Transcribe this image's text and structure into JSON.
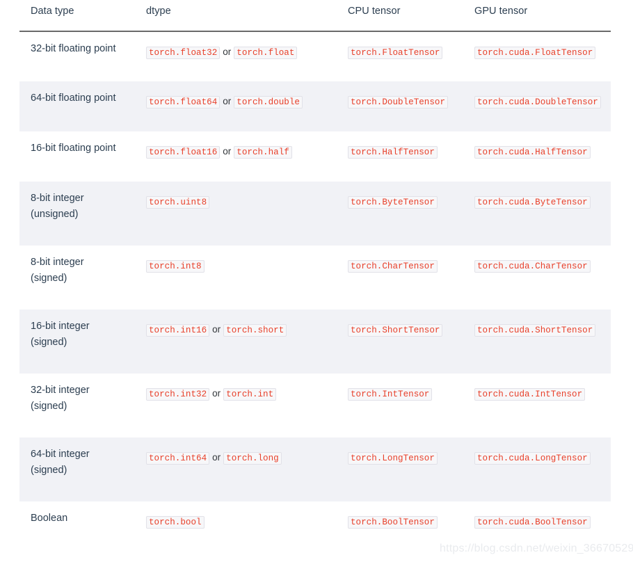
{
  "table": {
    "headers": [
      {
        "label": "Data type"
      },
      {
        "label": "dtype"
      },
      {
        "label": "CPU tensor"
      },
      {
        "label": "GPU tensor"
      }
    ],
    "rows": [
      {
        "data_type_line1": "32-bit floating point",
        "data_type_line2": "",
        "dtype_primary": "torch.float32",
        "dtype_conjunction": "or",
        "dtype_alt": "torch.float",
        "cpu_tensor": "torch.FloatTensor",
        "gpu_tensor": "torch.cuda.FloatTensor"
      },
      {
        "data_type_line1": "64-bit floating point",
        "data_type_line2": "",
        "dtype_primary": "torch.float64",
        "dtype_conjunction": "or",
        "dtype_alt": "torch.double",
        "cpu_tensor": "torch.DoubleTensor",
        "gpu_tensor": "torch.cuda.DoubleTensor"
      },
      {
        "data_type_line1": "16-bit floating point",
        "data_type_line2": "",
        "dtype_primary": "torch.float16",
        "dtype_conjunction": "or",
        "dtype_alt": "torch.half",
        "cpu_tensor": "torch.HalfTensor",
        "gpu_tensor": "torch.cuda.HalfTensor"
      },
      {
        "data_type_line1": "8-bit integer",
        "data_type_line2": "(unsigned)",
        "dtype_primary": "torch.uint8",
        "dtype_conjunction": "",
        "dtype_alt": "",
        "cpu_tensor": "torch.ByteTensor",
        "gpu_tensor": "torch.cuda.ByteTensor"
      },
      {
        "data_type_line1": "8-bit integer",
        "data_type_line2": "(signed)",
        "dtype_primary": "torch.int8",
        "dtype_conjunction": "",
        "dtype_alt": "",
        "cpu_tensor": "torch.CharTensor",
        "gpu_tensor": "torch.cuda.CharTensor"
      },
      {
        "data_type_line1": "16-bit integer",
        "data_type_line2": "(signed)",
        "dtype_primary": "torch.int16",
        "dtype_conjunction": "or",
        "dtype_alt": "torch.short",
        "cpu_tensor": "torch.ShortTensor",
        "gpu_tensor": "torch.cuda.ShortTensor"
      },
      {
        "data_type_line1": "32-bit integer",
        "data_type_line2": "(signed)",
        "dtype_primary": "torch.int32",
        "dtype_conjunction": "or",
        "dtype_alt": "torch.int",
        "cpu_tensor": "torch.IntTensor",
        "gpu_tensor": "torch.cuda.IntTensor"
      },
      {
        "data_type_line1": "64-bit integer",
        "data_type_line2": "(signed)",
        "dtype_primary": "torch.int64",
        "dtype_conjunction": "or",
        "dtype_alt": "torch.long",
        "cpu_tensor": "torch.LongTensor",
        "gpu_tensor": "torch.cuda.LongTensor"
      },
      {
        "data_type_line1": "Boolean",
        "data_type_line2": "",
        "dtype_primary": "torch.bool",
        "dtype_conjunction": "",
        "dtype_alt": "",
        "cpu_tensor": "torch.BoolTensor",
        "gpu_tensor": "torch.cuda.BoolTensor"
      }
    ]
  },
  "watermark": {
    "text": "https://blog.csdn.net/weixin_36670529"
  },
  "colors": {
    "code_text": "#e8402a",
    "code_background": "#f7f7f9",
    "code_border": "#e1e1e8",
    "text": "#2c3e50",
    "stripe_background": "#f1f2f6",
    "header_rule": "#6a6a6a",
    "watermark": "#e9ebee"
  }
}
